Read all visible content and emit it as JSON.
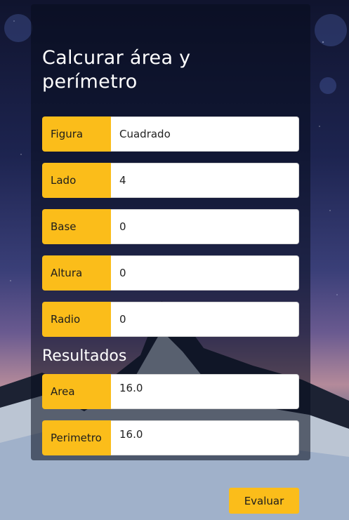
{
  "form": {
    "title": "Calcurar área y perímetro",
    "fields": [
      {
        "label": "Figura",
        "value": "Cuadrado"
      },
      {
        "label": "Lado",
        "value": "4"
      },
      {
        "label": "Base",
        "value": "0"
      },
      {
        "label": "Altura",
        "value": "0"
      },
      {
        "label": "Radio",
        "value": "0"
      }
    ]
  },
  "results": {
    "heading": "Resultados",
    "items": [
      {
        "label": "Area",
        "value": "16.0"
      },
      {
        "label": "Perimetro",
        "value": "16.0"
      }
    ]
  },
  "actions": {
    "evaluate_label": "Evaluar"
  },
  "colors": {
    "accent": "#fbbd1a",
    "panel": "#080c1e"
  }
}
